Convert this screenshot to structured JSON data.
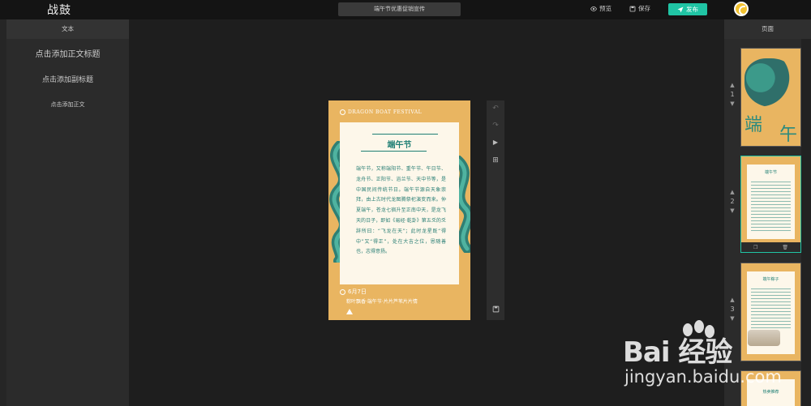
{
  "app": {
    "logo": "战鼓"
  },
  "header": {
    "doc_title": "端午节优惠促销宣传",
    "preview_label": "预览",
    "save_label": "保存",
    "publish_label": "发布"
  },
  "left_panel": {
    "heading": "文本",
    "add_title": "点击添加正文标题",
    "add_subtitle": "点击添加副标题",
    "add_body": "点击添加正文"
  },
  "poster": {
    "top_text": "DRAGON BOAT FESTIVAL",
    "title": "端午节",
    "body": "端午节，又称端阳节、重午节、午日节、龙舟节、正阳节、浴兰节、天中节等，是中国民间传统节日。端午节源自天象崇拜，由上古时代龙图腾祭祀演变而来。仲夏端午，苍龙七宿升至正南中天，是龙飞天的日子，即如《易经·乾卦》第五爻的爻辞所曰：“飞龙在天”；此时龙星既“得中”又“得正”，处在大吉之位，恩随善也，志得意扬。",
    "date": "6月7日",
    "subline": "粽叶飘香·端午节·片片芦苇片片情"
  },
  "right_panel": {
    "heading": "页面",
    "pages": [
      {
        "number": "1",
        "title": "",
        "big_char_1": "端",
        "big_char_2": "午"
      },
      {
        "number": "2",
        "title": "端午节"
      },
      {
        "number": "3",
        "title": "端午粽子"
      }
    ],
    "page4_title": "热卖推荐"
  },
  "watermark": {
    "brand": "Bai 经验",
    "url": "jingyan.baidu.com"
  },
  "colors": {
    "accent": "#20c4a4",
    "poster_bg": "#e9b561",
    "poster_teal": "#1f7f74"
  }
}
